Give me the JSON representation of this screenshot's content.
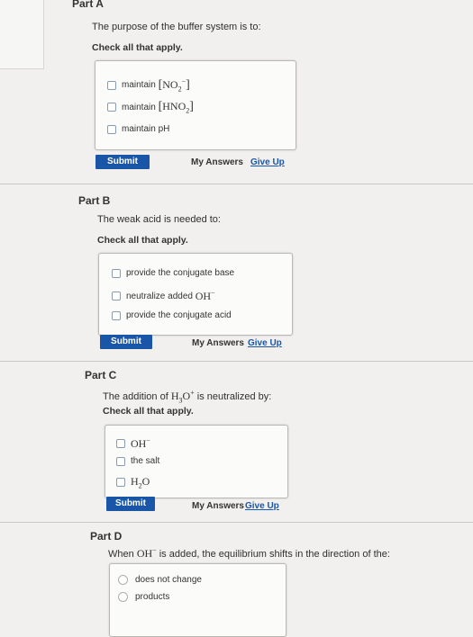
{
  "part_a": {
    "title": "Part A",
    "prompt": "The purpose of the buffer system is to:",
    "instruction": "Check all that apply.",
    "options": [
      "maintain",
      "maintain",
      "maintain pH"
    ],
    "option_formula_1": "NO",
    "option_formula_1_sub": "2",
    "option_formula_1_sup": "−",
    "option_formula_2": "HNO",
    "option_formula_2_sub": "2",
    "submit": "Submit",
    "my_answers": "My Answers",
    "give_up": "Give Up"
  },
  "part_b": {
    "title": "Part B",
    "prompt": "The weak acid is needed to:",
    "instruction": "Check all that apply.",
    "options": [
      "provide the conjugate base",
      "neutralize added",
      "provide the conjugate acid"
    ],
    "option_formula": "OH",
    "option_formula_sup": "−",
    "submit": "Submit",
    "my_answers": "My Answers",
    "give_up": "Give Up"
  },
  "part_c": {
    "title": "Part C",
    "prompt_prefix": "The addition of",
    "prompt_formula": "H",
    "prompt_formula_sub": "3",
    "prompt_formula_rest": "O",
    "prompt_formula_sup": "+",
    "prompt_suffix": "is neutralized by:",
    "instruction": "Check all that apply.",
    "options": [
      "OH",
      "the salt",
      "H"
    ],
    "option_1_sup": "−",
    "option_3_sub": "2",
    "option_3_rest": "O",
    "submit": "Submit",
    "my_answers": "My Answers",
    "give_up": "Give Up"
  },
  "part_d": {
    "title": "Part D",
    "prompt_prefix": "When",
    "prompt_formula": "OH",
    "prompt_formula_sup": "−",
    "prompt_suffix": "is added, the equilibrium shifts in the direction of the:",
    "options": [
      "does not change",
      "products"
    ]
  },
  "colors": {
    "accent": "#1a56a8",
    "background": "#f1f0ee",
    "panel": "#fbfbfa"
  }
}
